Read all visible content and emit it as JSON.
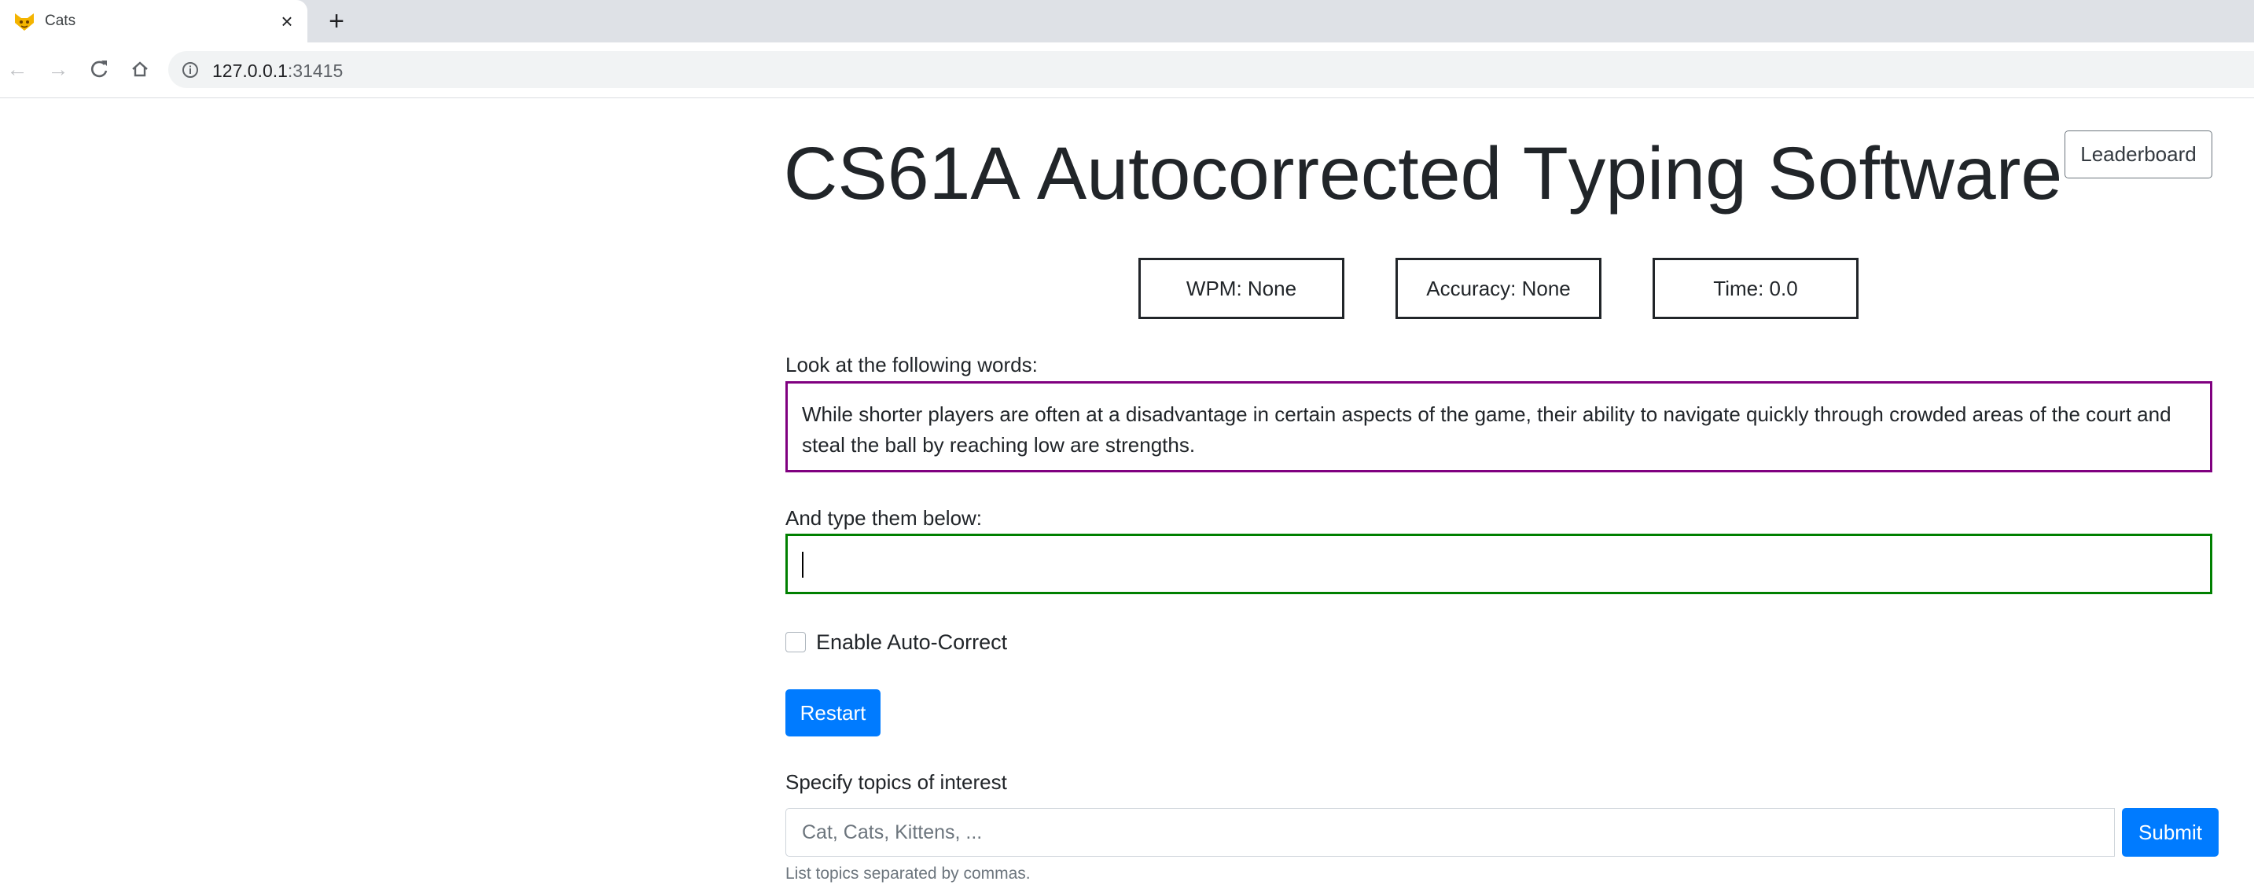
{
  "browser": {
    "tab_title": "Cats",
    "tab_favicon": "cat-face-icon",
    "url_host": "127.0.0.1",
    "url_port": ":31415"
  },
  "app": {
    "title_parts": [
      {
        "text": "C",
        "cap": true
      },
      {
        "text": "S61A ",
        "cap": false
      },
      {
        "text": "A",
        "cap": true
      },
      {
        "text": "utocorrected ",
        "cap": false
      },
      {
        "text": "T",
        "cap": true
      },
      {
        "text": "yping ",
        "cap": false
      },
      {
        "text": "S",
        "cap": true
      },
      {
        "text": "oftware",
        "cap": false
      }
    ],
    "leaderboard_label": "Leaderboard"
  },
  "stats": {
    "wpm": "WPM: None",
    "accuracy": "Accuracy: None",
    "time": "Time: 0.0"
  },
  "prompt": {
    "label": "Look at the following words:",
    "text": "While shorter players are often at a disadvantage in certain aspects of the game, their ability to navigate quickly through crowded areas of the court and steal the ball by reaching low are strengths."
  },
  "typing": {
    "label": "And type them below:",
    "value": ""
  },
  "autocorrect": {
    "label": "Enable Auto-Correct",
    "checked": false
  },
  "restart_label": "Restart",
  "topics": {
    "label": "Specify topics of interest",
    "placeholder": "Cat, Cats, Kittens, ...",
    "submit_label": "Submit",
    "help": "List topics separated by commas."
  },
  "colors": {
    "prompt_border": "#800080",
    "typing_border": "#008000",
    "primary_button": "#007bff"
  }
}
